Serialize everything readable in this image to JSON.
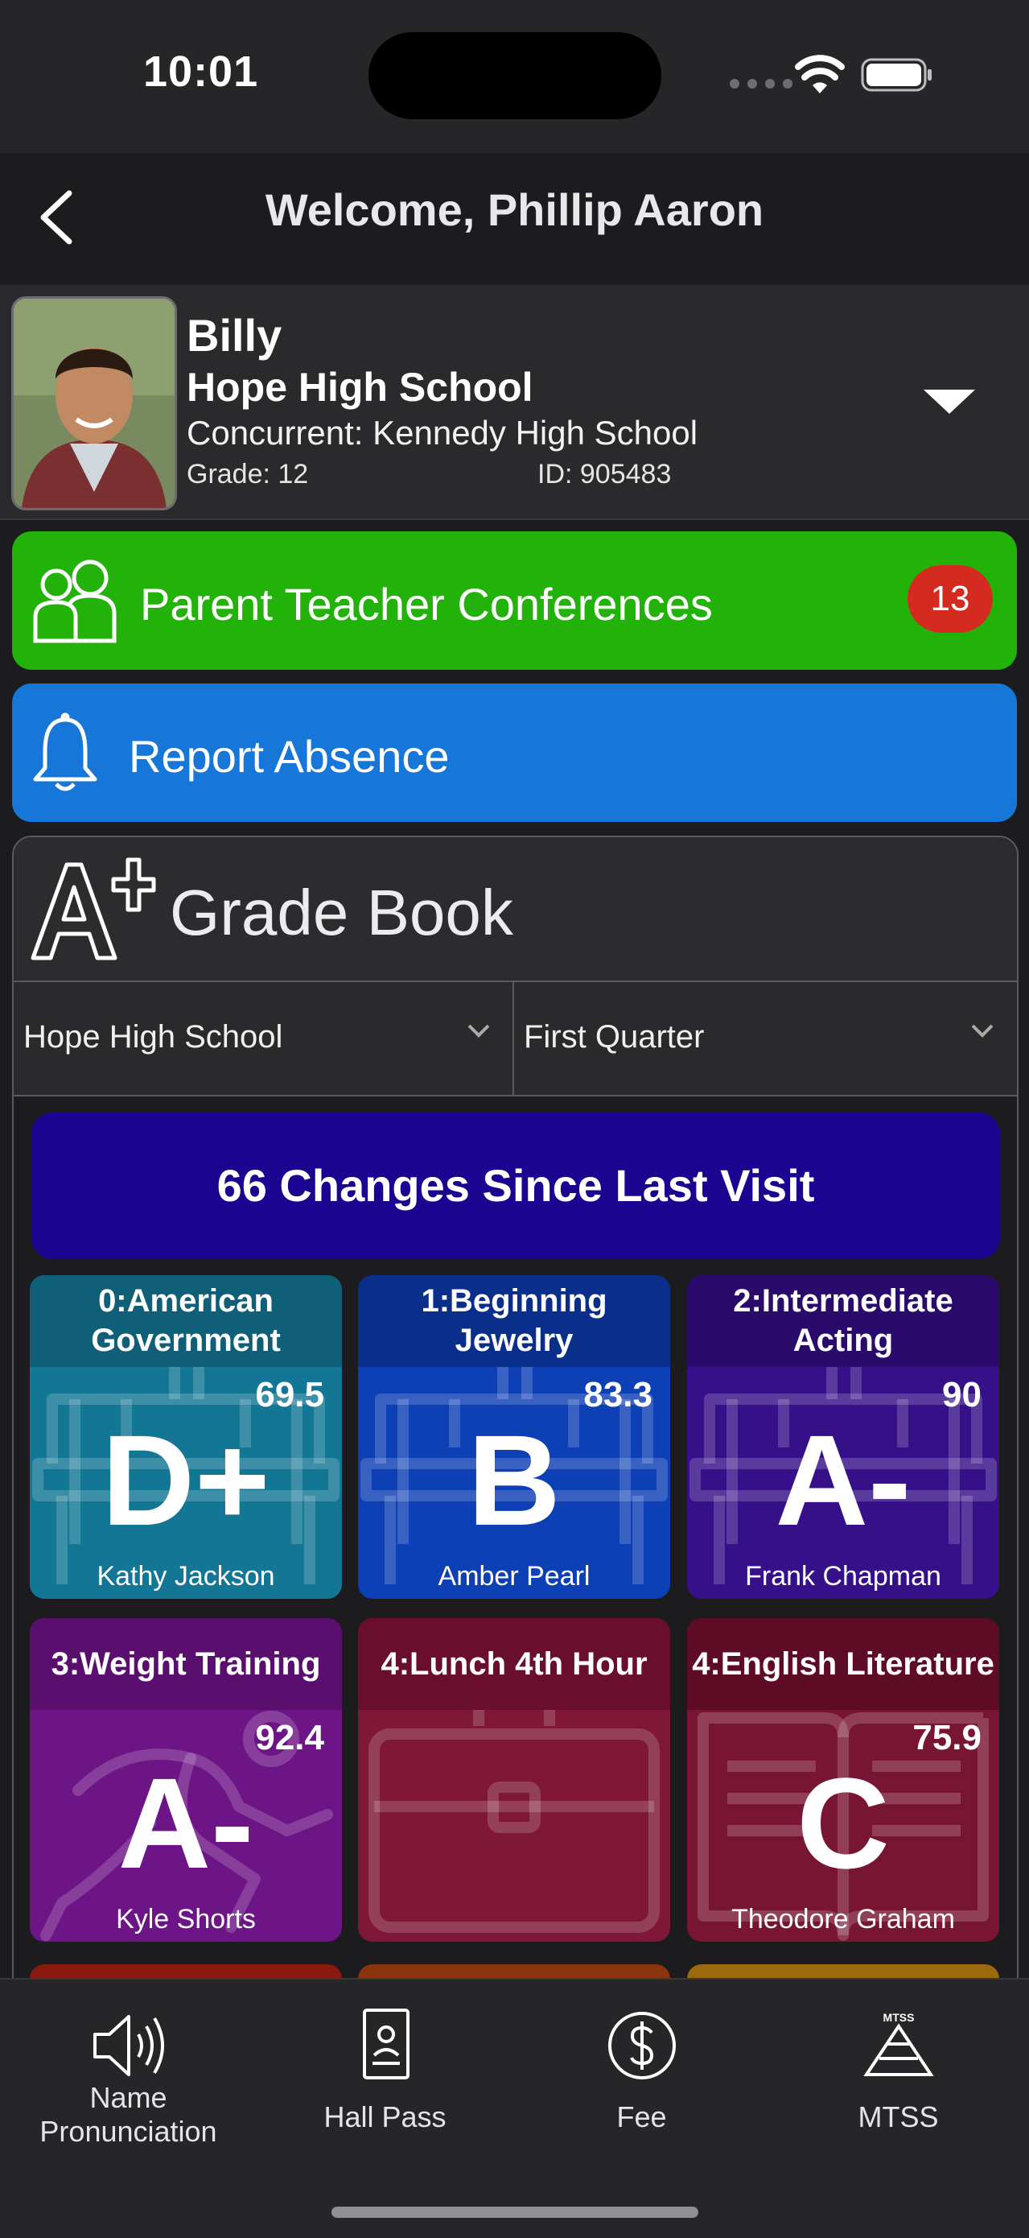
{
  "status_bar": {
    "time": "10:01"
  },
  "header": {
    "title": "Welcome, Phillip Aaron"
  },
  "student": {
    "name": "Billy",
    "school": "Hope High School",
    "concurrent": "Concurrent: Kennedy High School",
    "grade": "Grade: 12",
    "id": "ID: 905483"
  },
  "actions": {
    "conferences_label": "Parent Teacher Conferences",
    "conferences_count": "13",
    "absence_label": "Report Absence"
  },
  "gradebook": {
    "title": "Grade Book",
    "school_select": "Hope High School",
    "term_select": "First Quarter",
    "changes_banner": "66 Changes Since Last Visit",
    "classes": [
      {
        "name": "0:American Government",
        "percent": "69.5",
        "letter": "D+",
        "teacher": "Kathy Jackson",
        "icon": "desk-icon",
        "head_color": "#0f5f78",
        "body_color": "#137694"
      },
      {
        "name": "1:Beginning Jewelry",
        "percent": "83.3",
        "letter": "B",
        "teacher": "Amber Pearl",
        "icon": "desk-icon",
        "head_color": "#0a2f8a",
        "body_color": "#0d3fb5"
      },
      {
        "name": "2:Intermediate Acting",
        "percent": "90",
        "letter": "A-",
        "teacher": "Frank Chapman",
        "icon": "desk-icon",
        "head_color": "#2a0a6b",
        "body_color": "#351089"
      },
      {
        "name": "3:Weight Training",
        "percent": "92.4",
        "letter": "A-",
        "teacher": "Kyle Shorts",
        "icon": "runner-icon",
        "head_color": "#5a0f6e",
        "body_color": "#6d1586"
      },
      {
        "name": "4:Lunch 4th Hour",
        "percent": "",
        "letter": "",
        "teacher": "",
        "icon": "briefcase-icon",
        "head_color": "#6a0e2e",
        "body_color": "#7e1738"
      },
      {
        "name": "4:English Literature",
        "percent": "75.9",
        "letter": "C",
        "teacher": "Theodore Graham",
        "icon": "book-icon",
        "head_color": "#5e0c26",
        "body_color": "#781532"
      }
    ],
    "partial_colors": [
      "#8a1a10",
      "#8a3410",
      "#9a6a0c"
    ]
  },
  "tabbar": {
    "items": [
      {
        "label": "Name Pronunciation",
        "icon": "speaker-icon"
      },
      {
        "label": "Hall Pass",
        "icon": "hall-pass-icon"
      },
      {
        "label": "Fee",
        "icon": "dollar-icon"
      },
      {
        "label": "MTSS",
        "icon": "mtss-pyramid-icon"
      }
    ]
  }
}
